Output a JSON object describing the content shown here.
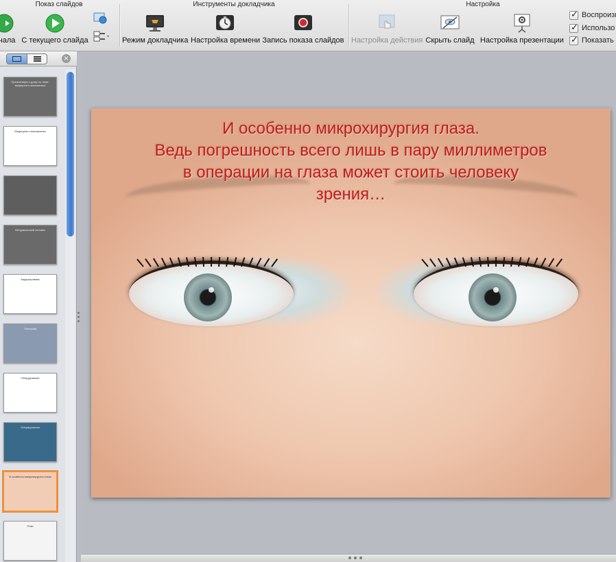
{
  "ribbon": {
    "groups": [
      {
        "title": "Показ слайдов"
      },
      {
        "title": "Инструменты докладчика"
      },
      {
        "title": "Настройка"
      }
    ],
    "buttons": {
      "from_start": "чала",
      "from_current": "С текущего слайда",
      "presenter_mode": "Режим докладчика",
      "rehearse_timings": "Настройка времени",
      "record_show": "Запись показа слайдов",
      "action_settings": "Настройка действия",
      "hide_slide": "Скрыть слайд",
      "setup_show": "Настройка презентации"
    },
    "checkboxes": [
      {
        "label": "Воспроизв",
        "checked": true
      },
      {
        "label": "Использо",
        "checked": true
      },
      {
        "label": "Показать",
        "checked": true
      }
    ]
  },
  "sidebar": {
    "thumbnails": [
      {
        "caption": "Презентация к уроку по теме: медицина и математика",
        "bg": "#6b6b6b",
        "selected": false
      },
      {
        "caption": "Медицина и математика",
        "bg": "#ffffff",
        "selected": false
      },
      {
        "caption": "",
        "bg": "#5e5e5e",
        "selected": false
      },
      {
        "caption": "Витрувианский человек",
        "bg": "#6a6a6a",
        "selected": false
      },
      {
        "caption": "Кардиограмма",
        "bg": "#ffffff",
        "selected": false
      },
      {
        "caption": "Томограф",
        "bg": "#8a9ab0",
        "selected": false
      },
      {
        "caption": "Оборудование",
        "bg": "#ffffff",
        "selected": false
      },
      {
        "caption": "Операционная",
        "bg": "#3a6a8a",
        "selected": false
      },
      {
        "caption": "И особенно микрохирургия глаза",
        "bg": "#f2cdb6",
        "selected": true
      },
      {
        "caption": "Очки",
        "bg": "#f4f4f4",
        "selected": false
      }
    ]
  },
  "slide": {
    "lines": [
      "И особенно микрохирургия глаза.",
      "Ведь погрешность всего лишь в пару миллиметров",
      "в операции на глаза может стоить человеку",
      "зрения…"
    ],
    "text_color": "#c31d16"
  },
  "colors": {
    "accent_selected": "#f0903a",
    "scroll_thumb": "#3b77cc"
  }
}
